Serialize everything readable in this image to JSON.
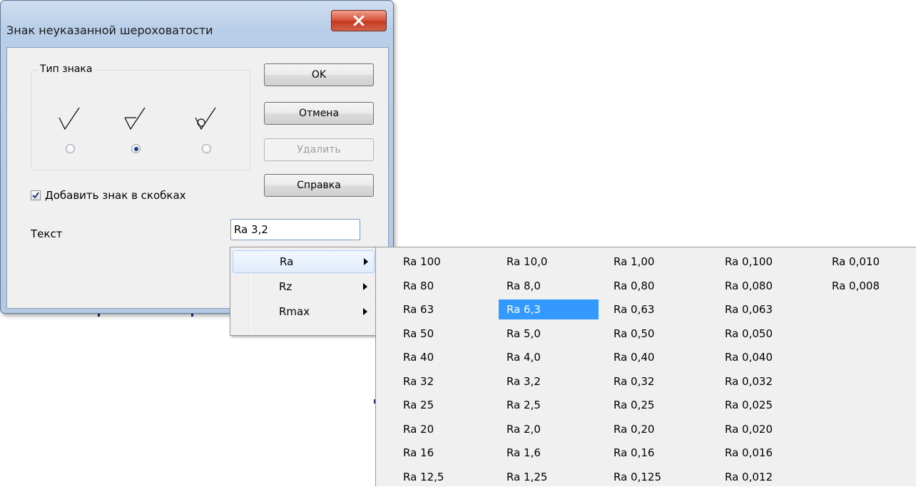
{
  "dialog": {
    "title": "Знак неуказанной шероховатости",
    "group_label": "Тип знака",
    "sign_types": [
      "no-removal-sign-icon",
      "removal-sign-icon",
      "no-removal-circle-sign-icon"
    ],
    "selected_sign_index": 1,
    "buttons": {
      "ok": "OK",
      "cancel": "Отмена",
      "delete": "Удалить",
      "help": "Справка"
    },
    "checkbox_label": "Добавить знак в скобках",
    "checkbox_checked": true,
    "text_label": "Текст",
    "text_value": "Ra 3,2"
  },
  "menu": {
    "items": [
      {
        "label": "Ra",
        "highlighted": true
      },
      {
        "label": "Rz",
        "highlighted": false
      },
      {
        "label": "Rmax",
        "highlighted": false
      }
    ]
  },
  "submenu": {
    "columns": [
      [
        "Ra 100",
        "Ra 80",
        "Ra 63",
        "Ra 50",
        "Ra 40",
        "Ra 32",
        "Ra 25",
        "Ra 20",
        "Ra 16",
        "Ra 12,5"
      ],
      [
        "Ra 10,0",
        "Ra 8,0",
        "Ra 6,3",
        "Ra 5,0",
        "Ra 4,0",
        "Ra 3,2",
        "Ra 2,5",
        "Ra 2,0",
        "Ra 1,6",
        "Ra 1,25"
      ],
      [
        "Ra 1,00",
        "Ra 0,80",
        "Ra 0,63",
        "Ra 0,50",
        "Ra 0,40",
        "Ra 0,32",
        "Ra 0,25",
        "Ra 0,20",
        "Ra 0,16",
        "Ra 0,125"
      ],
      [
        "Ra 0,100",
        "Ra 0,080",
        "Ra 0,063",
        "Ra 0,050",
        "Ra 0,040",
        "Ra 0,032",
        "Ra 0,025",
        "Ra 0,020",
        "Ra 0,016",
        "Ra 0,012"
      ],
      [
        "Ra 0,010",
        "Ra 0,008"
      ]
    ],
    "selected": "Ra 6,3",
    "highlight_color": "#3399ff"
  }
}
